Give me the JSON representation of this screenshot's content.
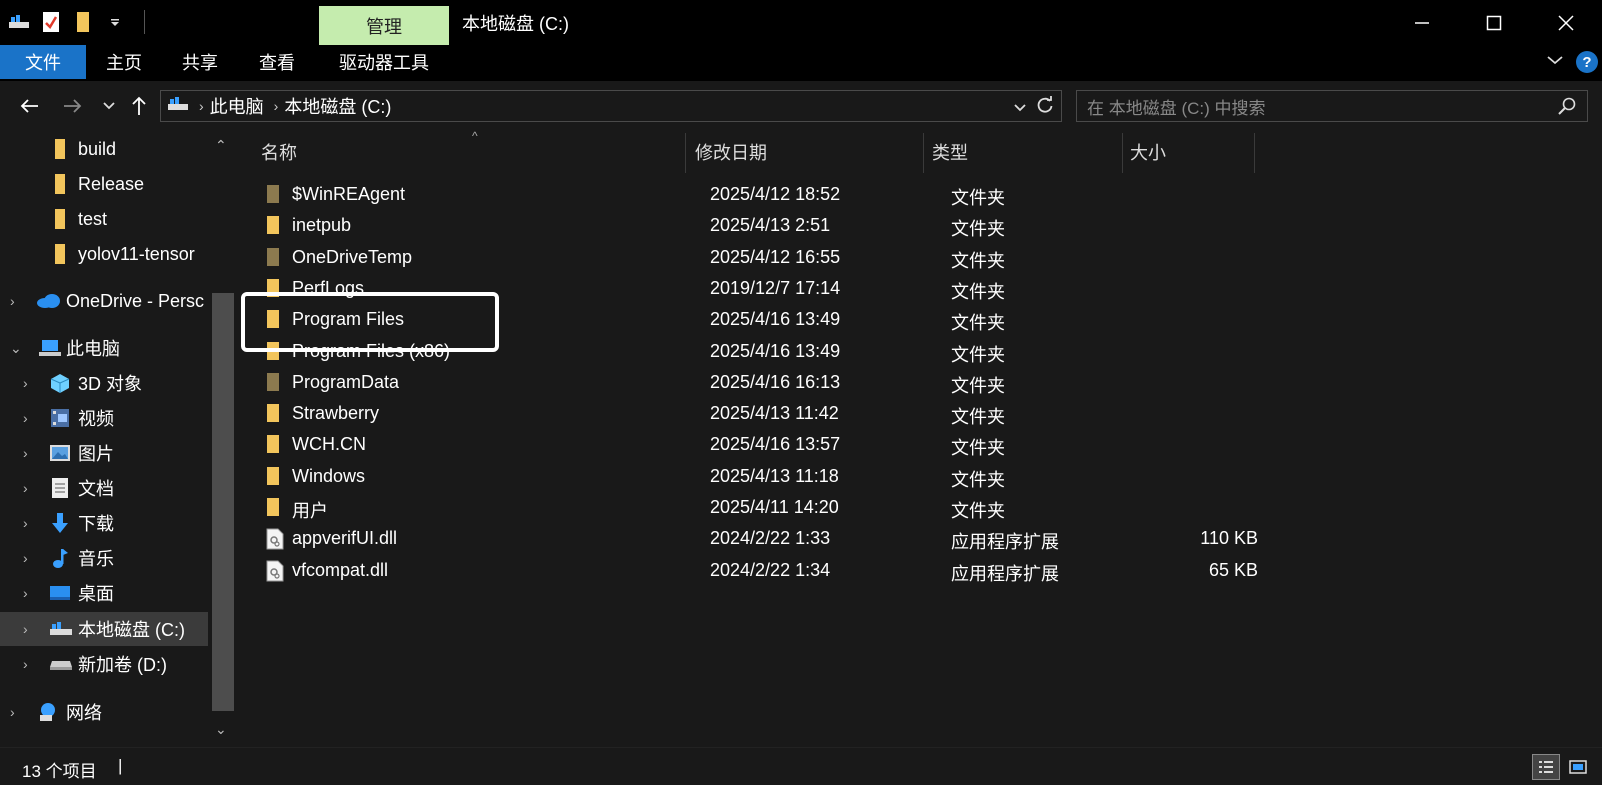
{
  "window": {
    "title": "本地磁盘 (C:)",
    "context_tab": "管理"
  },
  "ribbon": {
    "tabs": [
      "文件",
      "主页",
      "共享",
      "查看",
      "驱动器工具"
    ],
    "help": "?"
  },
  "address": {
    "crumbs": [
      "此电脑",
      "本地磁盘 (C:)"
    ],
    "search_placeholder": "在 本地磁盘 (C:) 中搜索"
  },
  "nav": {
    "items": [
      {
        "label": "build",
        "icon": "folder-icon",
        "expander": ""
      },
      {
        "label": "Release",
        "icon": "folder-icon",
        "expander": ""
      },
      {
        "label": "test",
        "icon": "folder-icon",
        "expander": ""
      },
      {
        "label": "yolov11-tensor",
        "icon": "folder-icon",
        "expander": ""
      },
      {
        "label": "OneDrive - Persc",
        "icon": "onedrive-cloud-icon",
        "expander": "collapsed"
      },
      {
        "label": "此电脑",
        "icon": "this-pc-icon",
        "expander": "expanded"
      },
      {
        "label": "3D 对象",
        "icon": "3d-objects-icon",
        "expander": "collapsed"
      },
      {
        "label": "视频",
        "icon": "videos-icon",
        "expander": "collapsed"
      },
      {
        "label": "图片",
        "icon": "pictures-icon",
        "expander": "collapsed"
      },
      {
        "label": "文档",
        "icon": "documents-icon",
        "expander": "collapsed"
      },
      {
        "label": "下载",
        "icon": "downloads-icon",
        "expander": "collapsed"
      },
      {
        "label": "音乐",
        "icon": "music-icon",
        "expander": "collapsed"
      },
      {
        "label": "桌面",
        "icon": "desktop-icon",
        "expander": "collapsed"
      },
      {
        "label": "本地磁盘 (C:)",
        "icon": "local-disk-icon",
        "expander": "collapsed",
        "selected": true
      },
      {
        "label": "新加卷 (D:)",
        "icon": "drive-icon",
        "expander": "collapsed"
      },
      {
        "label": "网络",
        "icon": "network-icon",
        "expander": "collapsed"
      }
    ]
  },
  "columns": {
    "name": "名称",
    "date": "修改日期",
    "type": "类型",
    "size": "大小"
  },
  "files": [
    {
      "name": "$WinREAgent",
      "date": "2025/4/12 18:52",
      "type": "文件夹",
      "size": "",
      "icon": "hidden-folder-icon"
    },
    {
      "name": "inetpub",
      "date": "2025/4/13 2:51",
      "type": "文件夹",
      "size": "",
      "icon": "folder-icon"
    },
    {
      "name": "OneDriveTemp",
      "date": "2025/4/12 16:55",
      "type": "文件夹",
      "size": "",
      "icon": "hidden-folder-icon"
    },
    {
      "name": "PerfLogs",
      "date": "2019/12/7 17:14",
      "type": "文件夹",
      "size": "",
      "icon": "folder-icon"
    },
    {
      "name": "Program Files",
      "date": "2025/4/16 13:49",
      "type": "文件夹",
      "size": "",
      "icon": "folder-icon"
    },
    {
      "name": "Program Files (x86)",
      "date": "2025/4/16 13:49",
      "type": "文件夹",
      "size": "",
      "icon": "folder-icon"
    },
    {
      "name": "ProgramData",
      "date": "2025/4/16 16:13",
      "type": "文件夹",
      "size": "",
      "icon": "hidden-folder-icon"
    },
    {
      "name": "Strawberry",
      "date": "2025/4/13 11:42",
      "type": "文件夹",
      "size": "",
      "icon": "folder-icon"
    },
    {
      "name": "WCH.CN",
      "date": "2025/4/16 13:57",
      "type": "文件夹",
      "size": "",
      "icon": "folder-icon"
    },
    {
      "name": "Windows",
      "date": "2025/4/13 11:18",
      "type": "文件夹",
      "size": "",
      "icon": "folder-icon"
    },
    {
      "name": "用户",
      "date": "2025/4/11 14:20",
      "type": "文件夹",
      "size": "",
      "icon": "folder-icon"
    },
    {
      "name": "appverifUI.dll",
      "date": "2024/2/22 1:33",
      "type": "应用程序扩展",
      "size": "110 KB",
      "icon": "dll-file-icon"
    },
    {
      "name": "vfcompat.dll",
      "date": "2024/2/22 1:34",
      "type": "应用程序扩展",
      "size": "65 KB",
      "icon": "dll-file-icon"
    }
  ],
  "highlighted_item": "Program Files",
  "status": {
    "count": "13 个项目",
    "cursor": "|"
  },
  "colors": {
    "accent": "#1a73c8",
    "context_tab": "#c5ecae",
    "folder": "#f2c55c",
    "hidden_folder": "#8c7a4f"
  }
}
